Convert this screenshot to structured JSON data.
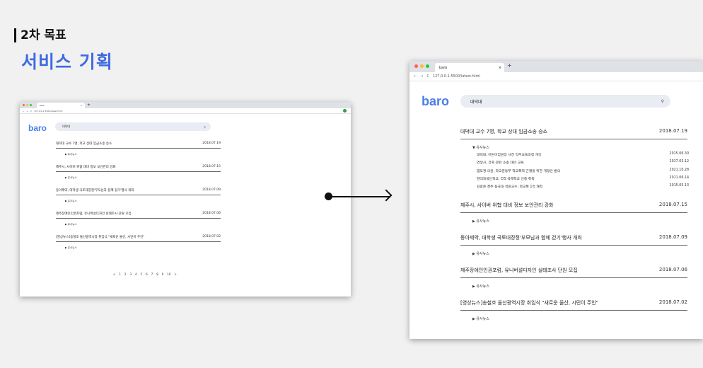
{
  "slide": {
    "subtitle": "2차 목표",
    "title": "서비스 기획"
  },
  "browser": {
    "tab_title": "baro",
    "tab_close": "×",
    "new_tab": "+",
    "nav_back": "←",
    "nav_forward": "→",
    "nav_reload": "C",
    "url_small": "127.0.0.1:5500/latest.html",
    "url_big": "127.0.0.1:5500/latest.html"
  },
  "app": {
    "logo": "baro",
    "search_query": "대덕대",
    "search_icon": "⚲",
    "related_toggle": "▶ 유사뉴스",
    "related_toggle_open": "▼ 유사뉴스"
  },
  "news_small": [
    {
      "title": "대덕대 교수 7명, 학교 상대 임금소송 승소",
      "date": "2018.07.19"
    },
    {
      "title": "제주시, 사이버 위협 대비 정보 보안관리 강화",
      "date": "2018.07.15"
    },
    {
      "title": "동아제약, 대학생 국토대장정'부모님과 함께 걷기'행사 개최",
      "date": "2018.07.09"
    },
    {
      "title": "제주장애인인권포럼, 유니버설디자인 실태조사 단원 모집",
      "date": "2018.07.06"
    },
    {
      "title": "[영상뉴스]송철호 울산광역시장 취임식 \"새로운 울산, 시민이 주인\"",
      "date": "2018.07.02"
    }
  ],
  "news_big": [
    {
      "title": "대덕대 교수 7명, 학교 상대 임금소송 승소",
      "date": "2018.07.19"
    },
    {
      "title": "제주시, 사이버 위협 대비 정보 보안관리 강화",
      "date": "2018.07.15"
    },
    {
      "title": "동아제약, 대학생 국토대장정'부모님과 함께 걷기'행사 개최",
      "date": "2018.07.09"
    },
    {
      "title": "제주장애인인권포럼, 유니버설디자인 실태조사 단원 모집",
      "date": "2018.07.06"
    },
    {
      "title": "[영상뉴스]송철호 울산광역시장 취임식 \"새로운 울산, 시민이 주인\"",
      "date": "2018.07.02"
    }
  ],
  "related_news": [
    {
      "title": "대덕대, 어린이집원장 사전 직무교육과정 개강",
      "date": "2015.06.30"
    },
    {
      "title": "연생시, 건축 관련 소송 대비 교육",
      "date": "2017.03.12"
    },
    {
      "title": "염모경 의원, 학교운동부 학교폭력 근절을 위한 개정안 발의",
      "date": "2021.10.28"
    },
    {
      "title": "현대외국인학교, CIS 국제학교 인증 취득",
      "date": "2011.06.14"
    },
    {
      "title": "김광운 경주 동국대 객원교수, 학교폭 1억 쾌척",
      "date": "2015.05.13"
    }
  ],
  "pagination": [
    "<",
    "1",
    "2",
    "3",
    "4",
    "5",
    "6",
    "7",
    "8",
    "9",
    "10",
    ">"
  ]
}
